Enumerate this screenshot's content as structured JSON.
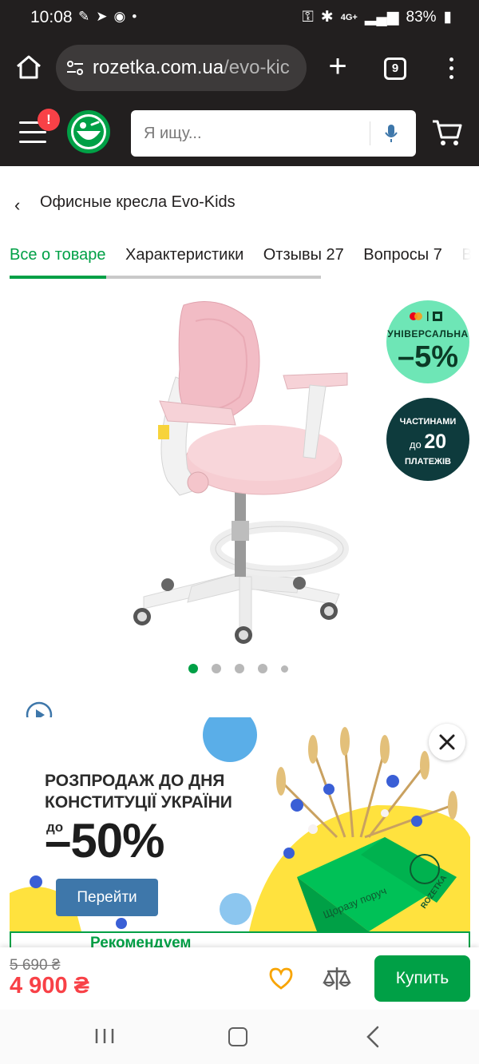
{
  "statusbar": {
    "time": "10:08",
    "battery": "83%",
    "network": "4G+"
  },
  "browser": {
    "url_host": "rozetka.com.ua",
    "url_path": "/evo-kic",
    "tab_count": "9"
  },
  "header": {
    "notification_badge": "!",
    "search_placeholder": "Я ищу..."
  },
  "breadcrumb": {
    "label": "Офисные кресла Evo-Kids"
  },
  "tabs": [
    {
      "label": "Все о товаре"
    },
    {
      "label": "Характеристики"
    },
    {
      "label": "Отзывы 27"
    },
    {
      "label": "Вопросы 7"
    },
    {
      "label": "В"
    }
  ],
  "badges": {
    "discount_label": "УНІВЕРСАЛЬНА",
    "discount_value": "–5%",
    "installment_line1": "ЧАСТИНАМИ",
    "installment_prefix": "до",
    "installment_number": "20",
    "installment_line3": "ПЛАТЕЖІВ"
  },
  "gallery": {
    "slide_count": 5,
    "active_slide": 1
  },
  "promo": {
    "line1": "РОЗПРОДАЖ ДО ДНЯ",
    "line2": "КОНСТИТУЦІЇ УКРАЇНИ",
    "prefix": "до",
    "percent": "–50%",
    "button_label": "Перейти",
    "box_text": "Щоразу поруч",
    "box_brand": "ROZETKA"
  },
  "recommend": {
    "label": "Рекомендуем"
  },
  "buybar": {
    "old_price": "5 690 ₴",
    "new_price": "4 900 ₴",
    "buy_label": "Купить"
  },
  "colors": {
    "accent": "#00a046",
    "price_red": "#f84147",
    "header_bg": "#221f1f",
    "promo_button": "#3e77aa"
  }
}
